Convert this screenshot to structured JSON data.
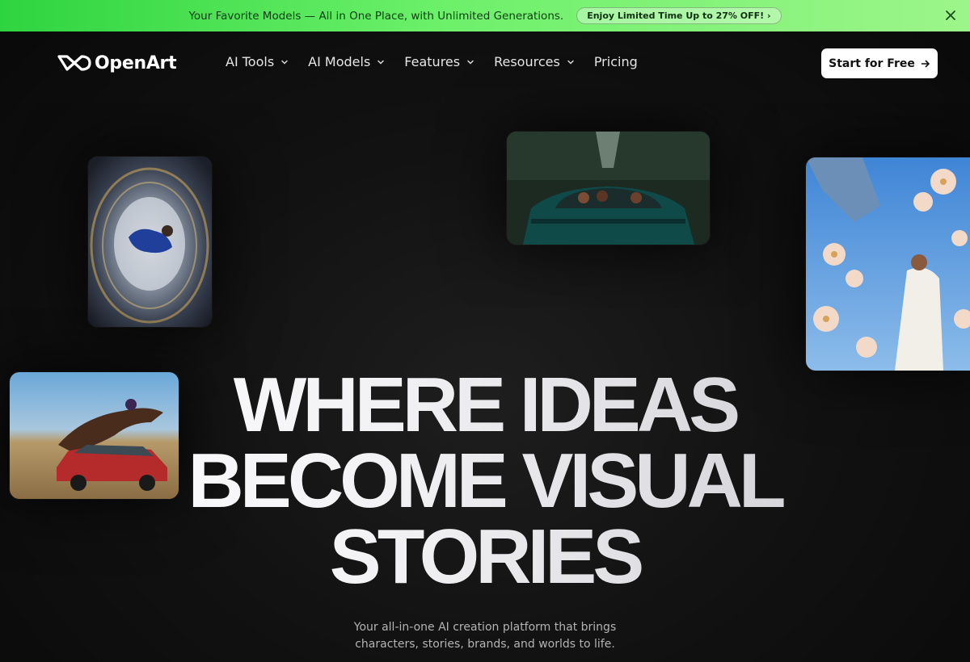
{
  "banner": {
    "text": "Your Favorite Models — All in One Place, with Unlimited Generations.",
    "offer_label": "Enjoy Limited Time Up to 27% OFF! ›",
    "close_icon": "close-icon"
  },
  "nav": {
    "logo_text": "OpenArt",
    "items": [
      {
        "label": "AI Tools",
        "has_dropdown": true
      },
      {
        "label": "AI Models",
        "has_dropdown": true
      },
      {
        "label": "Features",
        "has_dropdown": true
      },
      {
        "label": "Resources",
        "has_dropdown": true
      },
      {
        "label": "Pricing",
        "has_dropdown": false
      }
    ],
    "cta_label": "Start for Free",
    "cta_icon": "arrow-right-icon"
  },
  "hero": {
    "lines": [
      "WHERE IDEAS",
      "BECOME VISUAL",
      "STORIES"
    ],
    "subtitle_line1": "Your all-in-one AI creation platform that brings",
    "subtitle_line2": "characters, stories, brands, and worlds to life."
  },
  "colors": {
    "banner_green": "#5be35a",
    "background": "#0b0b0b",
    "cta_bg": "#ffffff"
  }
}
